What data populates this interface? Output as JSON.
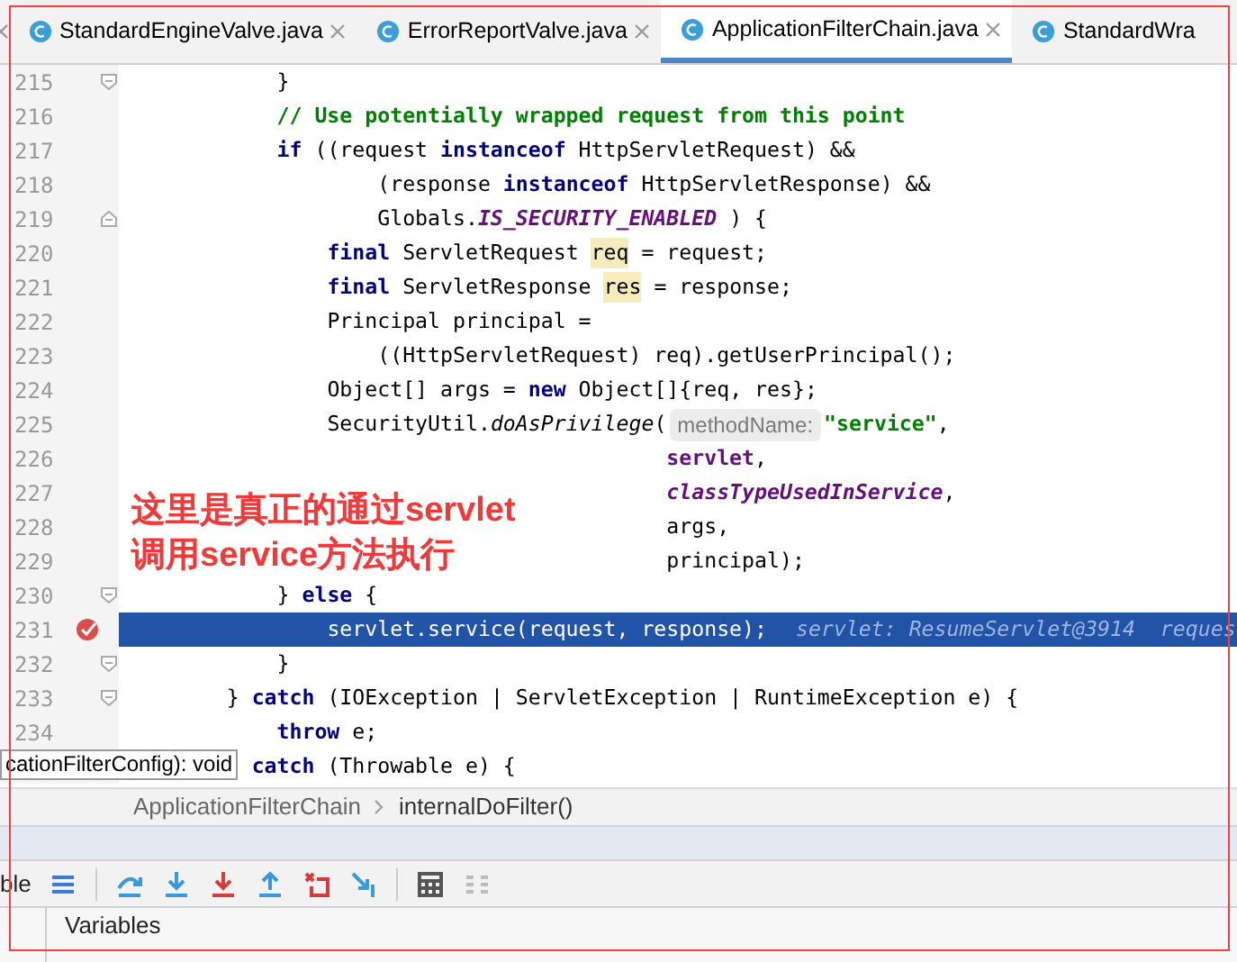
{
  "tabs": [
    {
      "label": "StandardEngineValve.java",
      "selected": false
    },
    {
      "label": "ErrorReportValve.java",
      "selected": false
    },
    {
      "label": "ApplicationFilterChain.java",
      "selected": true
    },
    {
      "label": "StandardWra",
      "selected": false
    }
  ],
  "editor": {
    "lines": [
      {
        "number": "215",
        "fold_open": false,
        "fold_close": true,
        "current": false,
        "breakpoint": false,
        "tokens": [
          {
            "kind": "plain",
            "text": "            }"
          }
        ]
      },
      {
        "number": "216",
        "fold_open": false,
        "fold_close": false,
        "current": false,
        "breakpoint": false,
        "tokens": [
          {
            "kind": "comment",
            "text": "            // Use potentially wrapped request from this point"
          }
        ]
      },
      {
        "number": "217",
        "fold_open": false,
        "fold_close": false,
        "current": false,
        "breakpoint": false,
        "tokens": [
          {
            "kind": "plain",
            "text": "            **if** ((request **instanceof** HttpServletRequest) &&"
          }
        ]
      },
      {
        "number": "218",
        "fold_open": false,
        "fold_close": false,
        "current": false,
        "breakpoint": false,
        "tokens": [
          {
            "kind": "plain",
            "text": "                    (response **instanceof** HttpServletResponse) &&"
          }
        ]
      },
      {
        "number": "219",
        "fold_open": true,
        "fold_close": false,
        "current": false,
        "breakpoint": false,
        "tokens": [
          {
            "kind": "plain",
            "text": "                    Globals."
          },
          {
            "kind": "static",
            "text": "IS_SECURITY_ENABLED"
          },
          {
            "kind": "plain",
            "text": " ) {"
          }
        ]
      },
      {
        "number": "220",
        "fold_open": false,
        "fold_close": false,
        "current": false,
        "breakpoint": false,
        "tokens": [
          {
            "kind": "plain",
            "text": "                **final** ServletRequest "
          },
          {
            "kind": "usage",
            "text": "req"
          },
          {
            "kind": "plain",
            "text": " = request;"
          }
        ]
      },
      {
        "number": "221",
        "fold_open": false,
        "fold_close": false,
        "current": false,
        "breakpoint": false,
        "tokens": [
          {
            "kind": "plain",
            "text": "                **final** ServletResponse "
          },
          {
            "kind": "usage",
            "text": "res"
          },
          {
            "kind": "plain",
            "text": " = response;"
          }
        ]
      },
      {
        "number": "222",
        "fold_open": false,
        "fold_close": false,
        "current": false,
        "breakpoint": false,
        "tokens": [
          {
            "kind": "plain",
            "text": "                Principal principal ="
          }
        ]
      },
      {
        "number": "223",
        "fold_open": false,
        "fold_close": false,
        "current": false,
        "breakpoint": false,
        "tokens": [
          {
            "kind": "plain",
            "text": "                    ((HttpServletRequest) req).getUserPrincipal();"
          }
        ]
      },
      {
        "number": "224",
        "fold_open": false,
        "fold_close": false,
        "current": false,
        "breakpoint": false,
        "tokens": [
          {
            "kind": "plain",
            "text": "                Object[] args = **new** Object[]{req, res};"
          }
        ]
      },
      {
        "number": "225",
        "fold_open": false,
        "fold_close": false,
        "current": false,
        "breakpoint": false,
        "tokens": [
          {
            "kind": "plain",
            "text": "                SecurityUtil."
          },
          {
            "kind": "method",
            "text": "doAsPrivilege"
          },
          {
            "kind": "plain",
            "text": "("
          },
          {
            "kind": "hint",
            "text": "methodName:"
          },
          {
            "kind": "string",
            "text": "\"service\""
          },
          {
            "kind": "plain",
            "text": ","
          }
        ]
      },
      {
        "number": "226",
        "fold_open": false,
        "fold_close": false,
        "current": false,
        "breakpoint": false,
        "tokens": [
          {
            "kind": "field",
            "text": "                                           servlet"
          },
          {
            "kind": "plain",
            "text": ","
          }
        ]
      },
      {
        "number": "227",
        "fold_open": false,
        "fold_close": false,
        "current": false,
        "breakpoint": false,
        "tokens": [
          {
            "kind": "static",
            "text": "                                           classTypeUsedInService"
          },
          {
            "kind": "plain",
            "text": ","
          }
        ]
      },
      {
        "number": "228",
        "fold_open": false,
        "fold_close": false,
        "current": false,
        "breakpoint": false,
        "tokens": [
          {
            "kind": "plain",
            "text": "                                           args,"
          }
        ]
      },
      {
        "number": "229",
        "fold_open": false,
        "fold_close": false,
        "current": false,
        "breakpoint": false,
        "tokens": [
          {
            "kind": "plain",
            "text": "                                           principal);"
          }
        ]
      },
      {
        "number": "230",
        "fold_open": false,
        "fold_close": true,
        "current": false,
        "breakpoint": false,
        "tokens": [
          {
            "kind": "plain",
            "text": "            } **else** {"
          }
        ]
      },
      {
        "number": "231",
        "fold_open": false,
        "fold_close": false,
        "current": true,
        "breakpoint": true,
        "tokens": [
          {
            "kind": "plain",
            "text": "                servlet.service(request, response);"
          },
          {
            "kind": "debug",
            "text": "servlet: ResumeServlet@3914  reques"
          }
        ]
      },
      {
        "number": "232",
        "fold_open": false,
        "fold_close": true,
        "current": false,
        "breakpoint": false,
        "tokens": [
          {
            "kind": "plain",
            "text": "            }"
          }
        ]
      },
      {
        "number": "233",
        "fold_open": false,
        "fold_close": true,
        "current": false,
        "breakpoint": false,
        "tokens": [
          {
            "kind": "plain",
            "text": "        } **catch** (IOException | ServletException | RuntimeException e) {"
          }
        ]
      },
      {
        "number": "234",
        "fold_open": false,
        "fold_close": false,
        "current": false,
        "breakpoint": false,
        "tokens": [
          {
            "kind": "plain",
            "text": "            **throw** e;"
          }
        ]
      },
      {
        "current": false,
        "tokens": [
          {
            "kind": "plain",
            "text": "          **catch** (Throwable e) {"
          }
        ]
      }
    ]
  },
  "tooltip": "cationFilterConfig): void",
  "annotation": [
    "这里是真正的通过servlet",
    "调用service方法执行"
  ],
  "breadcrumb": [
    "ApplicationFilterChain",
    "internalDoFilter()"
  ],
  "debug_toolbar": {
    "label": "ble"
  },
  "bottom_tab": "Variables"
}
